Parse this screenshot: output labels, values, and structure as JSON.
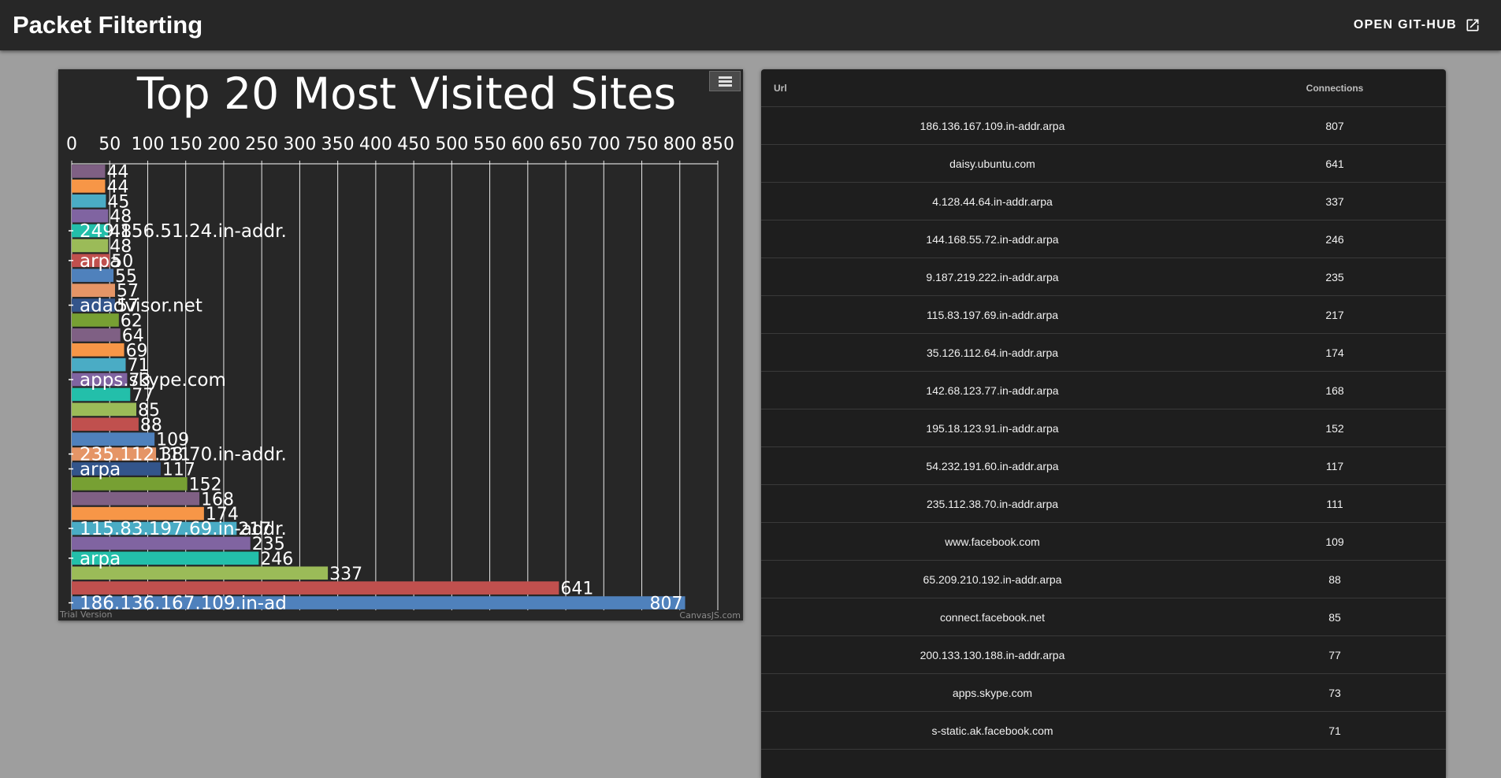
{
  "app": {
    "title": "Packet Filterting",
    "github_label": "OPEN GIT-HUB"
  },
  "chart_data": {
    "type": "bar",
    "orientation": "horizontal",
    "title": "Top 20 Most Visited Sites",
    "xlim": [
      0,
      850
    ],
    "x_ticks": [
      0,
      50,
      100,
      150,
      200,
      250,
      300,
      350,
      400,
      450,
      500,
      550,
      600,
      650,
      700,
      750,
      800,
      850
    ],
    "grid": true,
    "values": [
      807,
      641,
      337,
      246,
      235,
      217,
      174,
      168,
      152,
      117,
      111,
      109,
      88,
      85,
      77,
      73,
      71,
      69,
      64,
      62,
      57,
      57,
      55,
      50,
      48,
      48,
      48,
      45,
      44,
      44
    ],
    "bar_colors": [
      "#4f81bc",
      "#c0504e",
      "#9bbb58",
      "#23bfaa",
      "#8064a1",
      "#4aacc5",
      "#f79647",
      "#7f6084",
      "#77a033",
      "#33558b",
      "#e59566",
      "#4f81bc",
      "#c0504e",
      "#9bbb58",
      "#23bfaa",
      "#8064a1",
      "#4aacc5",
      "#f79647",
      "#7f6084",
      "#77a033",
      "#33558b",
      "#e59566",
      "#4f81bc",
      "#c0504e",
      "#9bbb58",
      "#23bfaa",
      "#8064a1",
      "#4aacc5",
      "#f79647",
      "#7f6084"
    ],
    "category_labels": [
      {
        "text": "186.136.167.109.in-ad",
        "bar_index": 0
      },
      {
        "text": "arpa",
        "bar_index": 3
      },
      {
        "text": "115.83.197.69.in-addr.",
        "bar_index": 5
      },
      {
        "text": "arpa",
        "bar_index": 9
      },
      {
        "text": "235.112.38.70.in-addr.",
        "bar_index": 10
      },
      {
        "text": "apps.skype.com",
        "bar_index": 15
      },
      {
        "text": "adadvisor.net",
        "bar_index": 20
      },
      {
        "text": "arpa",
        "bar_index": 23
      },
      {
        "text": "249.156.51.24.in-addr.",
        "bar_index": 25
      }
    ],
    "watermark_left": "Trial Version",
    "watermark_right": "CanvasJS.com"
  },
  "table": {
    "headers": {
      "url": "Url",
      "connections": "Connections"
    },
    "rows": [
      {
        "url": "186.136.167.109.in-addr.arpa",
        "connections": "807"
      },
      {
        "url": "daisy.ubuntu.com",
        "connections": "641"
      },
      {
        "url": "4.128.44.64.in-addr.arpa",
        "connections": "337"
      },
      {
        "url": "144.168.55.72.in-addr.arpa",
        "connections": "246"
      },
      {
        "url": "9.187.219.222.in-addr.arpa",
        "connections": "235"
      },
      {
        "url": "115.83.197.69.in-addr.arpa",
        "connections": "217"
      },
      {
        "url": "35.126.112.64.in-addr.arpa",
        "connections": "174"
      },
      {
        "url": "142.68.123.77.in-addr.arpa",
        "connections": "168"
      },
      {
        "url": "195.18.123.91.in-addr.arpa",
        "connections": "152"
      },
      {
        "url": "54.232.191.60.in-addr.arpa",
        "connections": "117"
      },
      {
        "url": "235.112.38.70.in-addr.arpa",
        "connections": "111"
      },
      {
        "url": "www.facebook.com",
        "connections": "109"
      },
      {
        "url": "65.209.210.192.in-addr.arpa",
        "connections": "88"
      },
      {
        "url": "connect.facebook.net",
        "connections": "85"
      },
      {
        "url": "200.133.130.188.in-addr.arpa",
        "connections": "77"
      },
      {
        "url": "apps.skype.com",
        "connections": "73"
      },
      {
        "url": "s-static.ak.facebook.com",
        "connections": "71"
      }
    ]
  }
}
